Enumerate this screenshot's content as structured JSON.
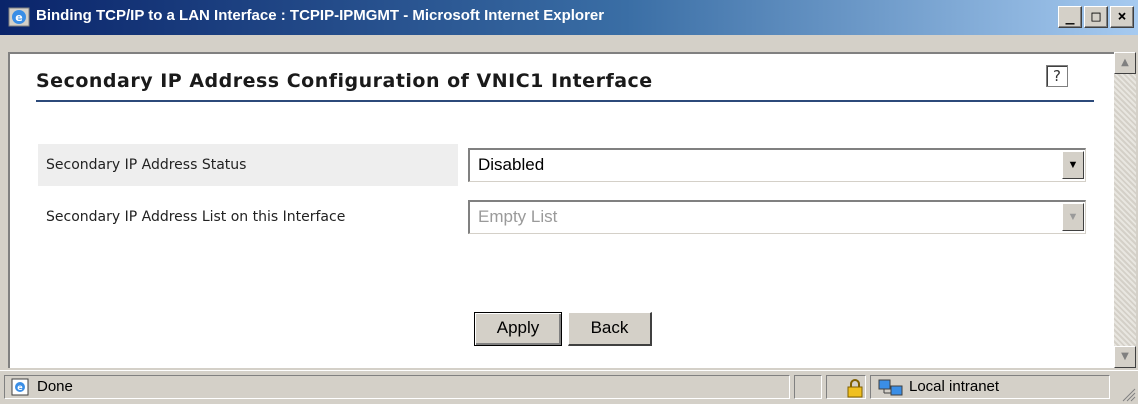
{
  "window": {
    "title": "Binding TCP/IP to a LAN Interface : TCPIP-IPMGMT - Microsoft Internet Explorer",
    "minimize_glyph": "_",
    "maximize_glyph": "□",
    "close_glyph": "×"
  },
  "page": {
    "title": "Secondary IP Address Configuration of VNIC1 Interface",
    "help_glyph": "?"
  },
  "form": {
    "status_label": "Secondary IP Address Status",
    "status_value": "Disabled",
    "list_label": "Secondary IP Address List on this Interface",
    "list_value": "Empty List",
    "apply_label": "Apply",
    "back_label": "Back"
  },
  "statusbar": {
    "status_text": "Done",
    "zone_text": "Local intranet"
  },
  "colors": {
    "titlebar_start": "#0a246a",
    "titlebar_end": "#a6caf0",
    "chrome": "#d4d0c8",
    "title_rule": "#2c4a7a"
  },
  "icons": [
    "ie-icon",
    "help-icon",
    "dropdown-arrow-icon",
    "scroll-up-icon",
    "scroll-down-icon",
    "page-done-icon",
    "lock-icon",
    "local-intranet-icon",
    "resize-grip-icon"
  ]
}
